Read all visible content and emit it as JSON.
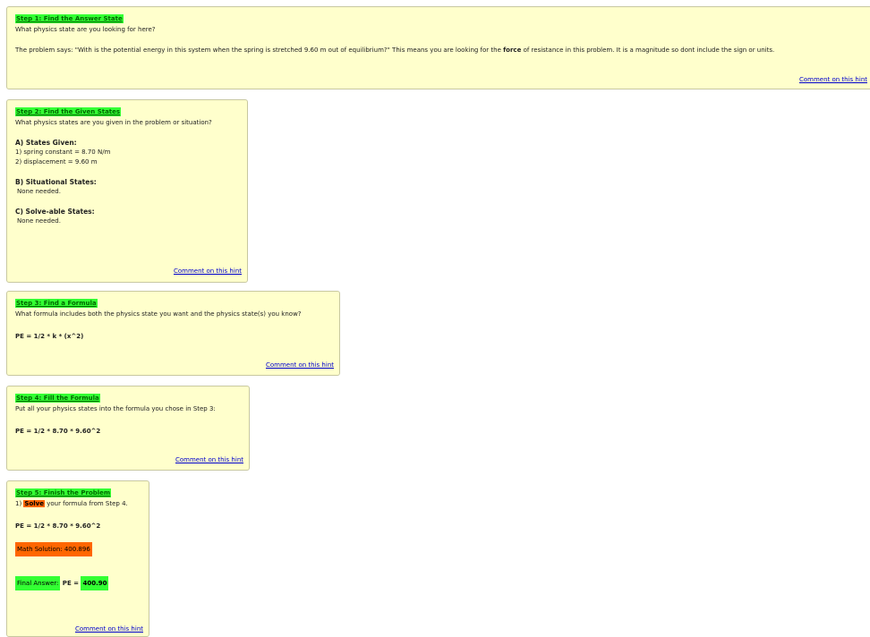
{
  "step1": {
    "title": "Step 1: Find the Answer State",
    "question": "What physics state are you looking for here?",
    "para_a": "The problem says: \"With is the potential energy in this system when the spring is stretched 9.60 m out of equilibrium?\" This means you are looking for the ",
    "para_bold": "force",
    "para_b": " of resistance in this problem. It is a magnitude so dont include the sign or units.",
    "comment": "Comment on this hint"
  },
  "step2": {
    "title": "Step 2: Find the Given States",
    "question": "What physics states are you given in the problem or situation?",
    "a_heading": "A) States Given:",
    "a_items": [
      "1) spring constant = 8.70 N/m",
      "2) displacement = 9.60 m"
    ],
    "b_heading": "B) Situational States:",
    "b_text": "None needed.",
    "c_heading": "C) Solve-able States:",
    "c_text": "None needed.",
    "comment": "Comment on this hint"
  },
  "step3": {
    "title": "Step 3: Find a Formula",
    "question": "What formula includes both the physics state you want and the physics state(s) you know?",
    "formula": "PE = 1/2 * k * (x^2)",
    "comment": "Comment on this hint"
  },
  "step4": {
    "title": "Step 4: Fill the Formula",
    "question": "Put all your physics states into the formula you chose in Step 3:",
    "formula": "PE = 1/2 * 8.70 * 9.60^2",
    "comment": "Comment on this hint"
  },
  "step5": {
    "title": "Step 5: Finish the Problem",
    "line_prefix": "1) ",
    "solve_word": "Solve",
    "line_suffix": " your formula from Step 4.",
    "formula": "PE = 1/2 * 8.70 * 9.60^2",
    "math_solution": "Math Solution:  400.896",
    "final_label": "Final Answer:",
    "final_pe": " PE = ",
    "final_value": "400.90",
    "comment": "Comment on this hint"
  },
  "colors": {
    "panel": "#ffffcc",
    "title_highlight": "#33ff33",
    "solve_highlight": "#ff6600",
    "link": "#0000cc"
  }
}
